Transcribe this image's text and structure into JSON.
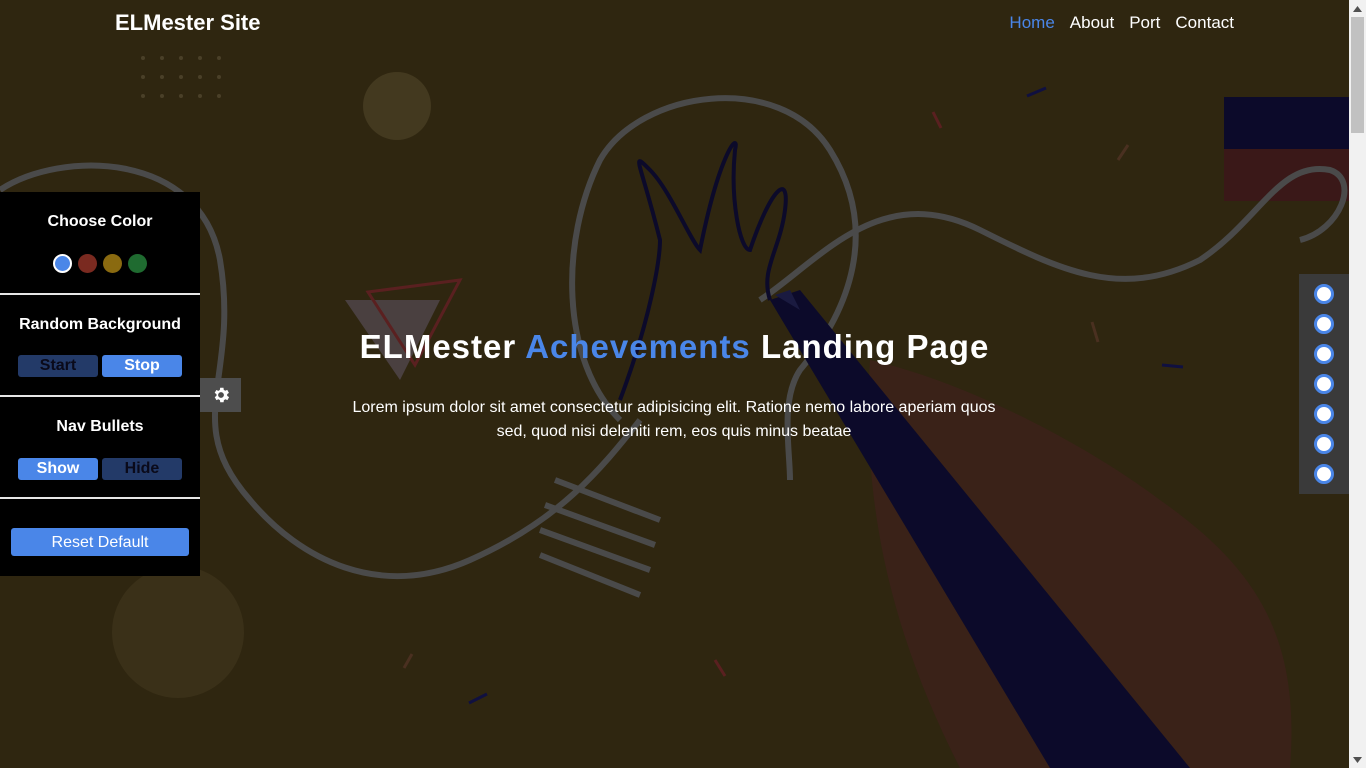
{
  "header": {
    "brand": "ELMester Site",
    "nav": [
      "Home",
      "About",
      "Port",
      "Contact"
    ],
    "active_nav": "Home"
  },
  "hero": {
    "title_start": "ELMester",
    "title_accent": "Achevements",
    "title_end": "Landing Page",
    "text": "Lorem ipsum dolor sit amet consectetur adipisicing elit. Ratione nemo labore aperiam quos sed, quod nisi deleniti rem, eos quis minus beatae"
  },
  "settings": {
    "choose_color": {
      "title": "Choose Color",
      "swatches": [
        "#4a86e8",
        "#7a2a20",
        "#8a6a10",
        "#1f6b30"
      ],
      "selected": "#4a86e8"
    },
    "random_background": {
      "title": "Random Background",
      "start": "Start",
      "stop": "Stop",
      "active": "Stop"
    },
    "nav_bullets": {
      "title": "Nav Bullets",
      "show": "Show",
      "hide": "Hide",
      "active": "Show"
    },
    "reset": "Reset Default",
    "toggle_icon": "gear-icon"
  },
  "bullets_count": 7,
  "colors": {
    "accent": "#4a86e8",
    "panel": "#000000",
    "background": "#2f2610"
  }
}
